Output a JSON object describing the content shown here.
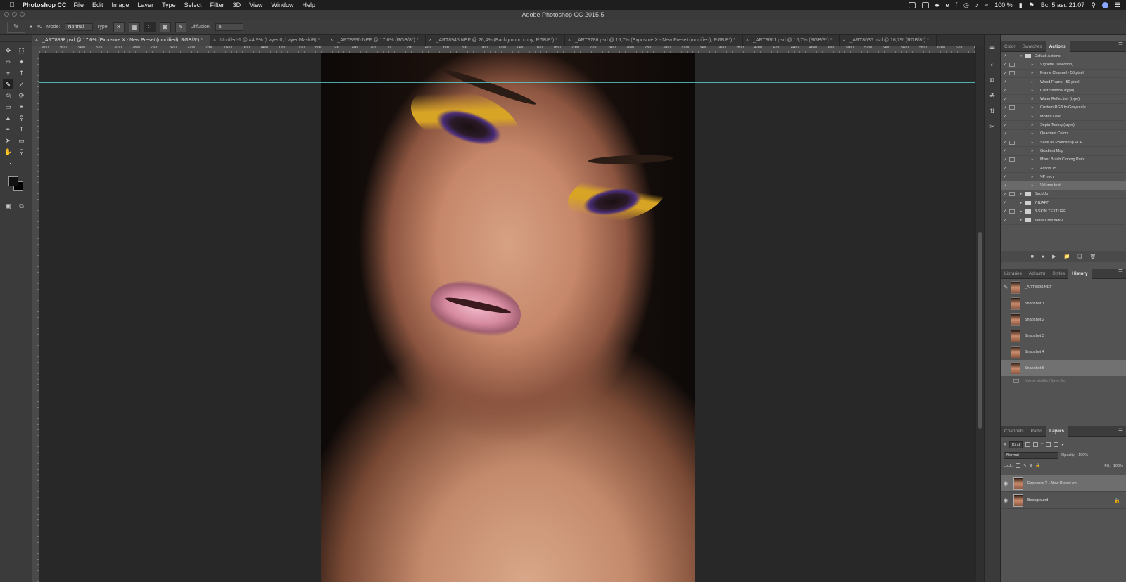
{
  "menubar": {
    "app_name": "Photoshop CC",
    "menus": [
      "File",
      "Edit",
      "Image",
      "Layer",
      "Type",
      "Select",
      "Filter",
      "3D",
      "View",
      "Window",
      "Help"
    ],
    "battery": "100 %",
    "clock": "Вс, 5 авг.  21:07"
  },
  "window": {
    "title": "Adobe Photoshop CC 2015.5"
  },
  "options": {
    "brush_size": "40",
    "mode_label": "Mode:",
    "mode_value": "Normal",
    "type_label": "Type:",
    "diffusion_label": "Diffusion:",
    "diffusion_value": "5"
  },
  "doc_tabs": [
    "_ART8898.psd @ 17,6% (Exposure X - New Preset (modified), RGB/8*) *",
    "Untitled-1 @ 44,9% (Layer 0, Layer Mask/8) *",
    "_ART8990.NEF @ 17,6% (RGB/8*) *",
    "_ART8945.NEF @ 26,4% (Background copy, RGB/8*) *",
    "_ART8786.psd @ 16,7% (Exposure X - New Preset (modified), RGB/8*) *",
    "_ART8661.psd @ 16,7% (RGB/8*) *",
    "_ART8636.psd @ 16,7% (RGB/8*) *"
  ],
  "ruler_labels": [
    "3800",
    "3600",
    "3400",
    "3200",
    "3000",
    "2800",
    "2600",
    "2400",
    "2200",
    "2000",
    "1800",
    "1600",
    "1400",
    "1200",
    "1000",
    "800",
    "600",
    "400",
    "200",
    "0",
    "200",
    "400",
    "600",
    "800",
    "1000",
    "1200",
    "1400",
    "1600",
    "1800",
    "2000",
    "2200",
    "2400",
    "2600",
    "2800",
    "3000",
    "3200",
    "3400",
    "3600",
    "3800",
    "4000",
    "4200",
    "4400",
    "4600",
    "4800",
    "5000",
    "5200",
    "5400",
    "5600",
    "5800",
    "6000",
    "6200",
    "6400",
    "6600",
    "6800",
    "7000",
    "7200",
    "7400",
    "7600"
  ],
  "top_panel": {
    "tabs": [
      "Color",
      "Swatches",
      "Actions"
    ],
    "active_tab": "Actions",
    "actions": [
      {
        "label": "Default Actions",
        "folder": true,
        "open": true
      },
      {
        "label": "Vignette (selection)",
        "dialog": true
      },
      {
        "label": "Frame Channel - 50 pixel",
        "dialog": true
      },
      {
        "label": "Wood Frame - 50 pixel",
        "dialog": false
      },
      {
        "label": "Cast Shadow (type)",
        "dialog": false
      },
      {
        "label": "Water Reflection (type)",
        "dialog": false
      },
      {
        "label": "Custom RGB to Grayscale",
        "dialog": true
      },
      {
        "label": "Molten Lead",
        "dialog": false
      },
      {
        "label": "Sepia Toning (layer)",
        "dialog": false
      },
      {
        "label": "Quadrant Colors",
        "dialog": false
      },
      {
        "label": "Save as Photoshop PDF",
        "dialog": true
      },
      {
        "label": "Gradient Map",
        "dialog": false
      },
      {
        "label": "Mixer Brush Cloning Paint ...",
        "dialog": true
      },
      {
        "label": "Action 15",
        "dialog": false
      },
      {
        "label": "ЧР тест",
        "dialog": false
      },
      {
        "label": "Volume test",
        "dialog": false,
        "selected": true
      },
      {
        "label": "BackUp",
        "folder": true,
        "dialog": true
      },
      {
        "label": "7-ШАРП",
        "folder": true,
        "dialog": false
      },
      {
        "label": "8-SKIN TEXTURE",
        "folder": true,
        "dialog": true
      },
      {
        "label": "качает менкдер",
        "folder": true,
        "dialog": false
      }
    ]
  },
  "history_panel": {
    "tabs": [
      "Libraries",
      "Adjustm",
      "Styles",
      "History"
    ],
    "active_tab": "History",
    "items": [
      {
        "label": "_ART8898.NEF",
        "source": true
      },
      {
        "label": "Snapshot 1"
      },
      {
        "label": "Snapshot 2"
      },
      {
        "label": "Snapshot 3"
      },
      {
        "label": "Snapshot 4"
      },
      {
        "label": "Snapshot 5",
        "selected": true
      }
    ],
    "state": "Merge Visible (Save As)"
  },
  "layers_panel": {
    "tabs": [
      "Channels",
      "Paths",
      "Layers"
    ],
    "active_tab": "Layers",
    "filter": "Kind",
    "blend_mode": "Normal",
    "opacity_label": "Opacity:",
    "opacity_value": "100%",
    "lock_label": "Lock:",
    "fill_label": "Fill:",
    "fill_value": "100%",
    "layers": [
      {
        "name": "Exposure X - New Preset (m...",
        "selected": true
      },
      {
        "name": "Background",
        "locked": true
      }
    ]
  }
}
